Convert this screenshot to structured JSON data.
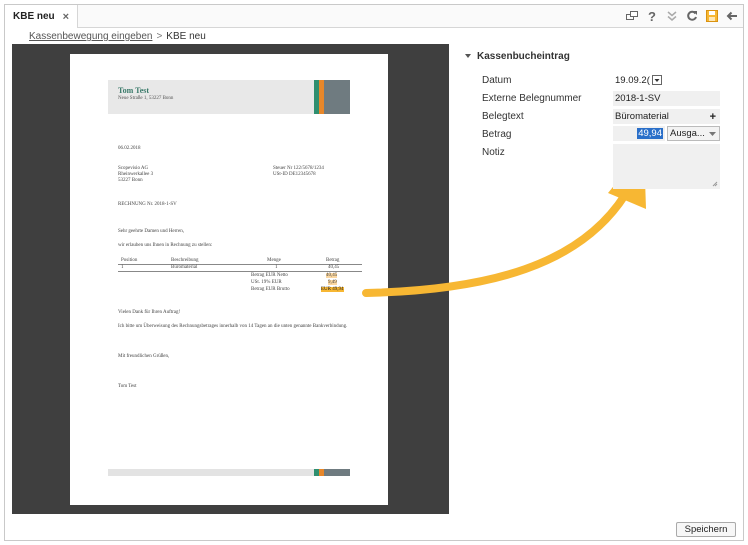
{
  "tab": {
    "title": "KBE neu",
    "close": "×"
  },
  "toolbar": {
    "icons": [
      "window-icon",
      "help-icon",
      "double-chevron-icon",
      "refresh-icon",
      "save-icon",
      "back-arrow-icon"
    ]
  },
  "breadcrumb": {
    "parent": "Kassenbewegung eingeben",
    "sep": ">",
    "current": "KBE neu"
  },
  "document": {
    "name": "Tom Test",
    "address": "Neue Straße 1, 53227 Bonn",
    "date": "06.02.2018",
    "recipient": [
      "Scopevisio AG",
      "Rheinwerkallee 3",
      "53227 Bonn"
    ],
    "tax": [
      "Steuer Nr 122/5678/1234",
      "USt-ID DE12345678"
    ],
    "invoice_no": "RECHNUNG Nr. 2018-1-SV",
    "greeting": "Sehr geehrte Damen und Herren,",
    "intro": "wir erlauben uns Ihnen in Rechnung zu stellen:",
    "table_head": [
      "Position",
      "Beschreibung",
      "Menge",
      "Betrag"
    ],
    "table_row": [
      "1",
      "Büromaterial",
      "1",
      "40,45"
    ],
    "sums": [
      {
        "label": "Betrag EUR Netto",
        "value": "40,45"
      },
      {
        "label": "USt. 19% EUR",
        "value": "9,49"
      },
      {
        "label": "Betrag EUR Brutto",
        "value": "EUR 49,94"
      }
    ],
    "thanks": "Vielen Dank für Ihren Auftrag!",
    "request": "Ich bitte um Überweisung des Rechnungsbetrages innerhalb von 14 Tagen an die unten genannte Bankverbindung.",
    "closing": "Mit freundlichen Grüßen,",
    "signature": "Tom Test"
  },
  "form": {
    "section": "Kassenbucheintrag",
    "datum_label": "Datum",
    "datum_value": "19.09.2(",
    "beleg_label": "Externe Belegnummer",
    "beleg_value": "2018-1-SV",
    "text_label": "Belegtext",
    "text_value": "Büromaterial",
    "text_add": "+",
    "betrag_label": "Betrag",
    "betrag_value": "49,94",
    "type_value": "Ausga...",
    "notiz_label": "Notiz"
  },
  "save_button": "Speichern",
  "colors": {
    "accent": "#f7b733",
    "brand_green": "#2f8f6f",
    "brand_orange": "#e8872a"
  }
}
